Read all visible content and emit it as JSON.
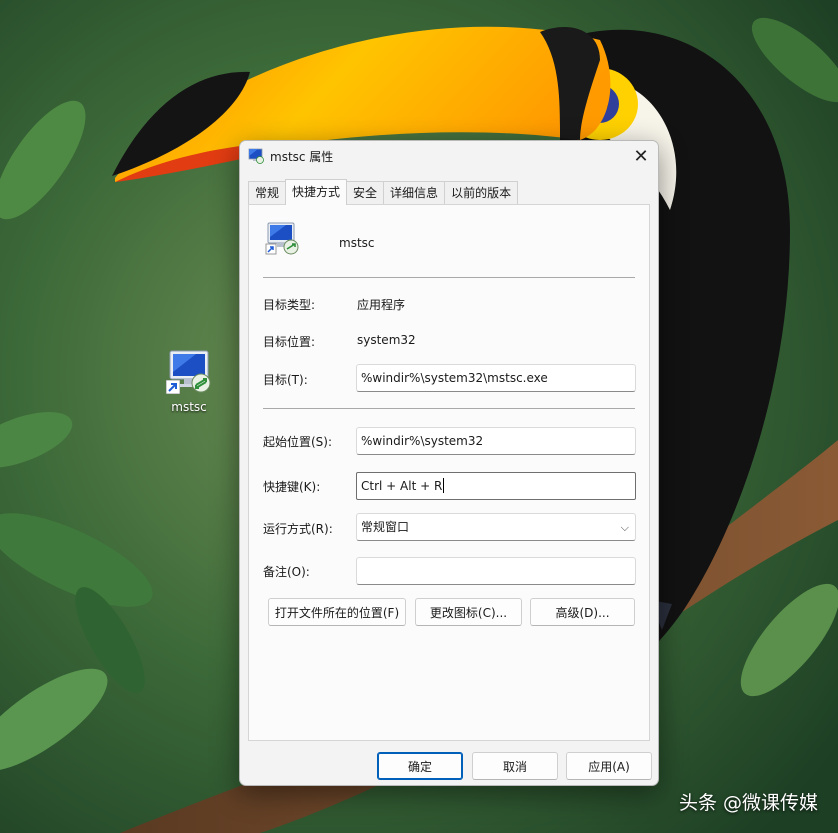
{
  "desktop": {
    "icon_label": "mstsc"
  },
  "dialog": {
    "title": "mstsc 属性",
    "close_glyph": "✕",
    "tabs": [
      {
        "label": "常规",
        "active": false
      },
      {
        "label": "快捷方式",
        "active": true
      },
      {
        "label": "安全",
        "active": false
      },
      {
        "label": "详细信息",
        "active": false
      },
      {
        "label": "以前的版本",
        "active": false
      }
    ],
    "app_name": "mstsc",
    "target_type": {
      "label": "目标类型:",
      "value": "应用程序"
    },
    "target_location": {
      "label": "目标位置:",
      "value": "system32"
    },
    "target": {
      "label": "目标(T):",
      "value": "%windir%\\system32\\mstsc.exe"
    },
    "start_in": {
      "label": "起始位置(S):",
      "value": "%windir%\\system32"
    },
    "shortcut_key": {
      "label": "快捷键(K):",
      "value": "Ctrl + Alt + R"
    },
    "run": {
      "label": "运行方式(R):",
      "value": "常规窗口"
    },
    "comment": {
      "label": "备注(O):",
      "value": ""
    },
    "buttons": {
      "open_location": "打开文件所在的位置(F)",
      "change_icon": "更改图标(C)...",
      "advanced": "高级(D)..."
    },
    "footer": {
      "ok": "确定",
      "cancel": "取消",
      "apply": "应用(A)"
    }
  },
  "watermark": "头条 @微课传媒",
  "icons": {
    "app": "remote-desktop-icon",
    "shortcut": "shortcut-arrow-icon",
    "close": "close-icon",
    "dropdown": "chevron-down-icon"
  },
  "colors": {
    "primary_border": "#005fb8",
    "dialog_bg": "#f3f3f3",
    "panel_bg": "#fbfbfb"
  }
}
